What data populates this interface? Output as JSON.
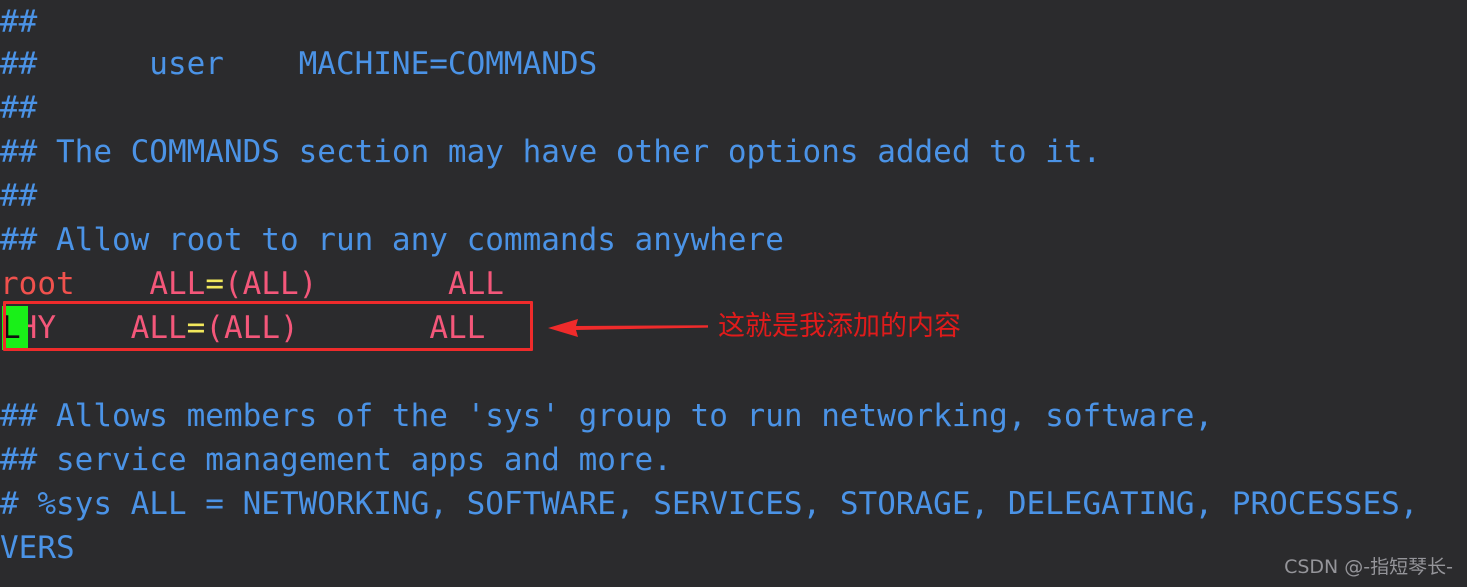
{
  "theme": {
    "background": "#2b2b2d",
    "comment_color": "#4b93e6",
    "root_color": "#f0514d",
    "rule_color": "#f4577a",
    "equals_color": "#f2e85c",
    "cursor_bg": "#19f018",
    "cursor_fg": "#101010",
    "annotation_color": "#ef2b2b",
    "watermark_color": "#9b9ba0"
  },
  "editor": {
    "file_kind": "sudoers",
    "lines": [
      {
        "text": "##",
        "kind": "comment"
      },
      {
        "text": "##      user    MACHINE=COMMANDS",
        "kind": "comment"
      },
      {
        "text": "##",
        "kind": "comment"
      },
      {
        "text": "## The COMMANDS section may have other options added to it.",
        "kind": "comment"
      },
      {
        "text": "##",
        "kind": "comment"
      },
      {
        "text": "## Allow root to run any commands anywhere",
        "kind": "comment"
      },
      {
        "text": "root",
        "rule_spacer": "    ",
        "lhs": "ALL",
        "eq": "=",
        "rhs": "(ALL)",
        "gap": "       ",
        "cmds": "ALL",
        "kind": "rule-root"
      },
      {
        "text": "LHY",
        "rule_spacer": "    ",
        "lhs": "ALL",
        "eq": "=",
        "rhs": "(ALL)",
        "gap": "       ",
        "cmds": "ALL",
        "kind": "rule-user",
        "cursor_char": "L",
        "highlighted": true
      },
      {
        "text": "",
        "kind": "blank"
      },
      {
        "text": "## Allows members of the 'sys' group to run networking, software,",
        "kind": "comment"
      },
      {
        "text": "## service management apps and more.",
        "kind": "comment"
      },
      {
        "text": "# %sys ALL = NETWORKING, SOFTWARE, SERVICES, STORAGE, DELEGATING, PROCESSES,",
        "kind": "comment"
      },
      {
        "text": "VERS",
        "kind": "comment"
      }
    ]
  },
  "annotation": {
    "callout_text": "这就是我添加的内容",
    "box_label": "highlight-added-sudoers-line",
    "arrow_direction": "left"
  },
  "watermark": {
    "text": "CSDN @-指短琴长-"
  }
}
